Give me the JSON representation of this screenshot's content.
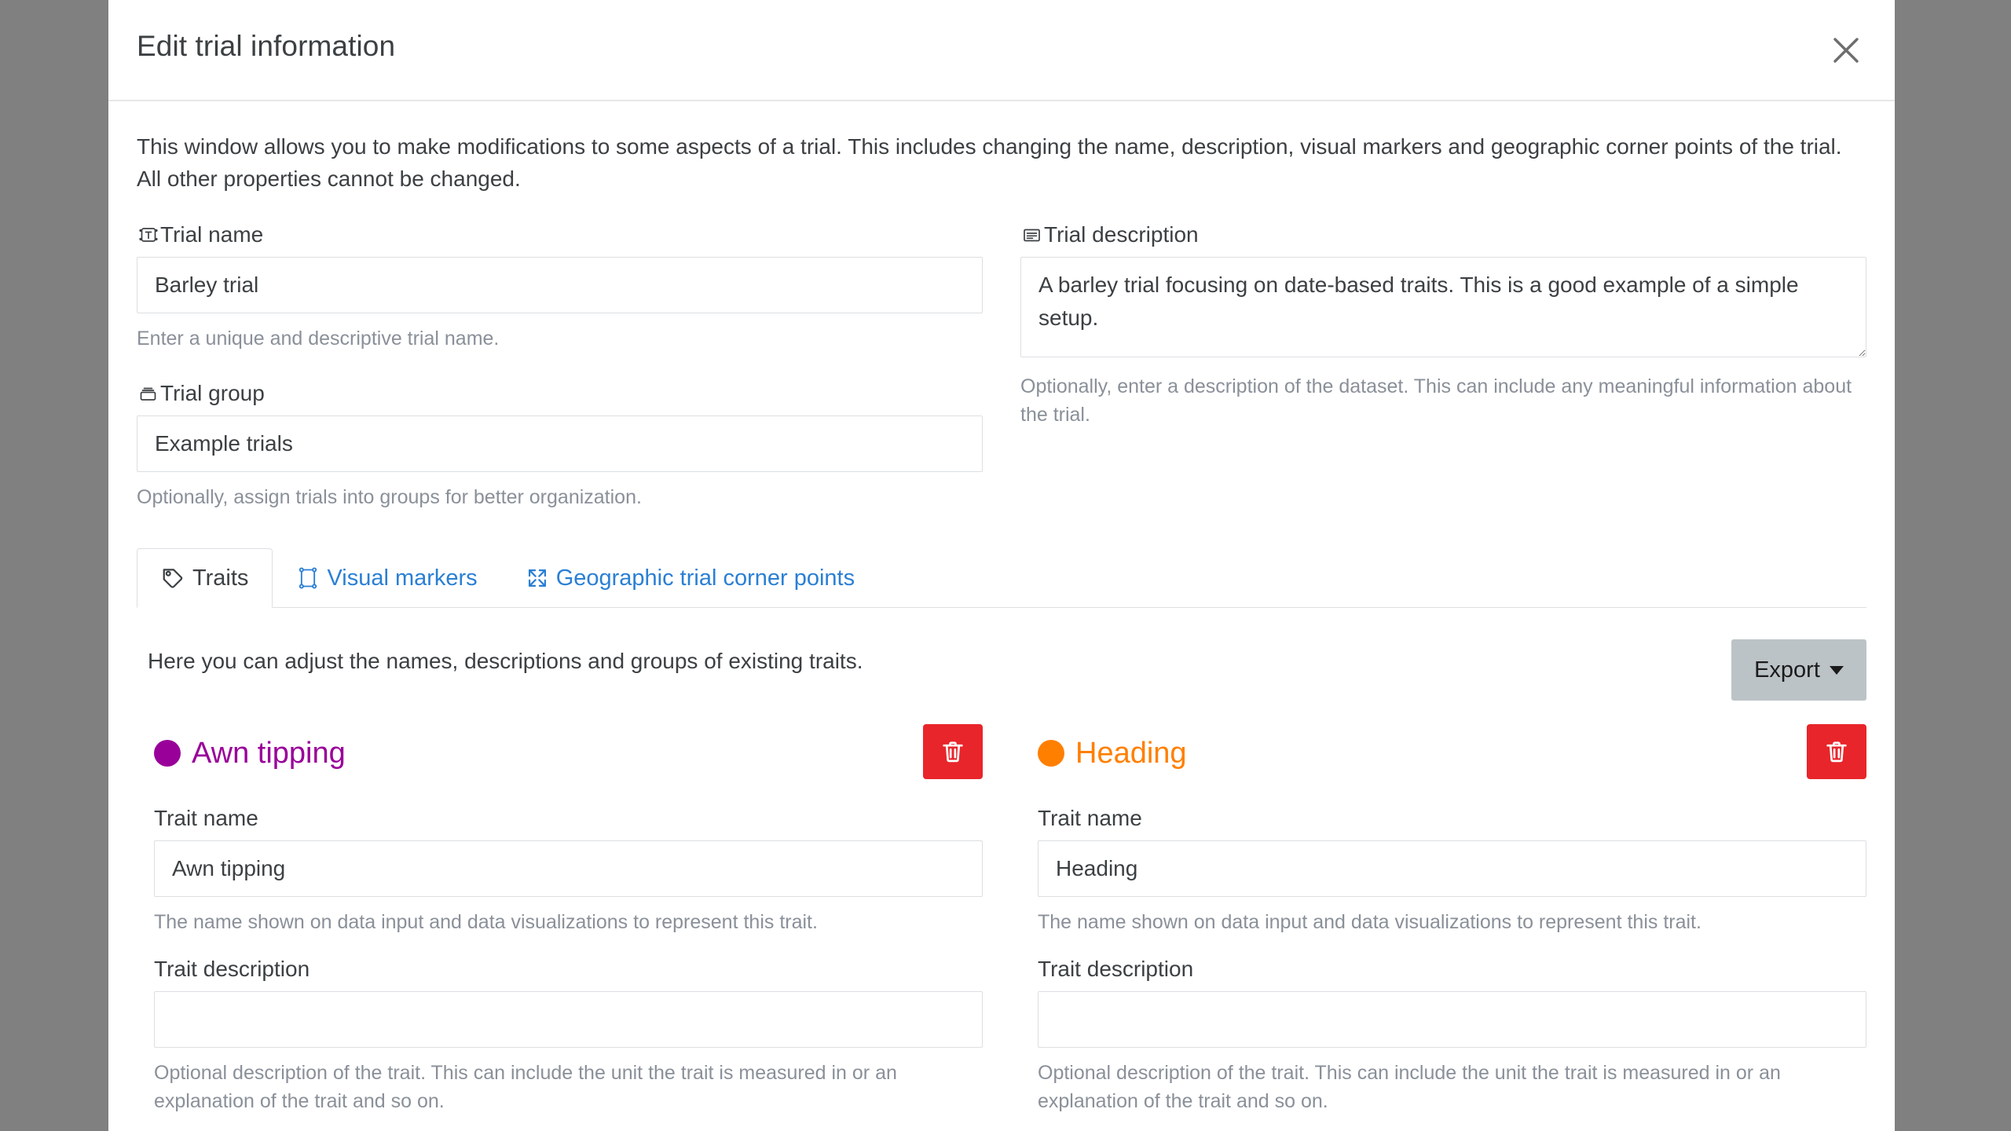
{
  "window": {
    "title": "Edit trial information",
    "close_icon": "close-icon"
  },
  "intro": "This window allows you to make modifications to some aspects of a trial. This includes changing the name, description, visual markers and geographic corner points of the trial. All other properties cannot be changed.",
  "fields": {
    "trial_name": {
      "label": "Trial name",
      "icon": "text-label-icon",
      "value": "Barley trial",
      "placeholder": "",
      "help": "Enter a unique and descriptive trial name."
    },
    "trial_group": {
      "label": "Trial group",
      "icon": "collection-icon",
      "value": "Example trials",
      "placeholder": "",
      "help": "Optionally, assign trials into groups for better organization."
    },
    "trial_description": {
      "label": "Trial description",
      "icon": "description-lines-icon",
      "value": "A barley trial focusing on date-based traits. This is a good example of a simple setup.",
      "placeholder": "",
      "help": "Optionally, enter a description of the dataset. This can include any meaningful information about the trial."
    }
  },
  "tabs": [
    {
      "label": "Traits",
      "icon": "tag-icon",
      "active": true
    },
    {
      "label": "Visual markers",
      "icon": "bounding-box-icon",
      "active": false
    },
    {
      "label": "Geographic trial corner points",
      "icon": "expand-arrows-icon",
      "active": false
    }
  ],
  "traits_section": {
    "note": "Here you can adjust the names, descriptions and groups of existing traits.",
    "export_label": "Export",
    "export_caret_icon": "chevron-down-icon",
    "trait_name_label": "Trait name",
    "trait_name_help": "The name shown on data input and data visualizations to represent this trait.",
    "trait_description_label": "Trait description",
    "trait_description_help": "Optional description of the trait. This can include the unit the trait is measured in or an explanation of the trait and so on.",
    "delete_icon": "trash-icon",
    "traits": [
      {
        "title": "Awn tipping",
        "color": "#990099",
        "name_value": "Awn tipping",
        "description_value": ""
      },
      {
        "title": "Heading",
        "color": "#ff7f00",
        "name_value": "Heading",
        "description_value": ""
      }
    ]
  },
  "colors": {
    "accent_link": "#2a7fd4",
    "danger": "#e8252a",
    "button_grey": "#bcc3c7",
    "text": "#3c4043",
    "muted": "#8a9099",
    "backdrop": "#808080"
  }
}
